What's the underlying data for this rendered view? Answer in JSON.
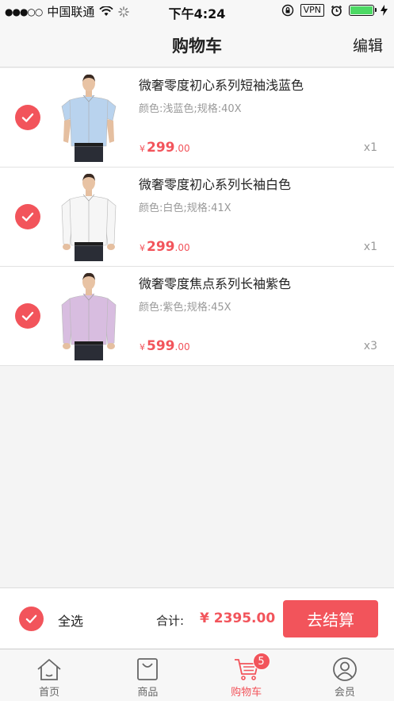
{
  "status_bar": {
    "signal": "●●●○○",
    "carrier": "中国联通",
    "time": "下午4:24",
    "vpn": "VPN",
    "battery_level": 1.0
  },
  "nav": {
    "title": "购物车",
    "edit": "编辑"
  },
  "cart_items": [
    {
      "name": "微奢零度初心系列短袖浅蓝色",
      "spec": "颜色:浅蓝色;规格:40X",
      "currency": "¥",
      "price_int": "299",
      "price_dec": ".00",
      "qty": "x1",
      "checked": true,
      "shirt_color": "#b9d3ee",
      "sleeve": "short"
    },
    {
      "name": "微奢零度初心系列长袖白色",
      "spec": "颜色:白色;规格:41X",
      "currency": "¥",
      "price_int": "299",
      "price_dec": ".00",
      "qty": "x1",
      "checked": true,
      "shirt_color": "#f6f6f6",
      "sleeve": "long"
    },
    {
      "name": "微奢零度焦点系列长袖紫色",
      "spec": "颜色:紫色;规格:45X",
      "currency": "¥",
      "price_int": "599",
      "price_dec": ".00",
      "qty": "x3",
      "checked": true,
      "shirt_color": "#d8bde0",
      "sleeve": "long"
    }
  ],
  "checkout": {
    "select_all": "全选",
    "total_label": "合计:",
    "total_value": "¥ 2395.00",
    "button": "去结算"
  },
  "tabs": [
    {
      "label": "首页",
      "icon": "home-icon",
      "active": false
    },
    {
      "label": "商品",
      "icon": "shopping-bag-icon",
      "active": false
    },
    {
      "label": "购物车",
      "icon": "cart-icon",
      "active": true,
      "badge": "5"
    },
    {
      "label": "会员",
      "icon": "user-icon",
      "active": false
    }
  ],
  "colors": {
    "accent": "#f2545b",
    "tab_inactive": "#666666"
  }
}
